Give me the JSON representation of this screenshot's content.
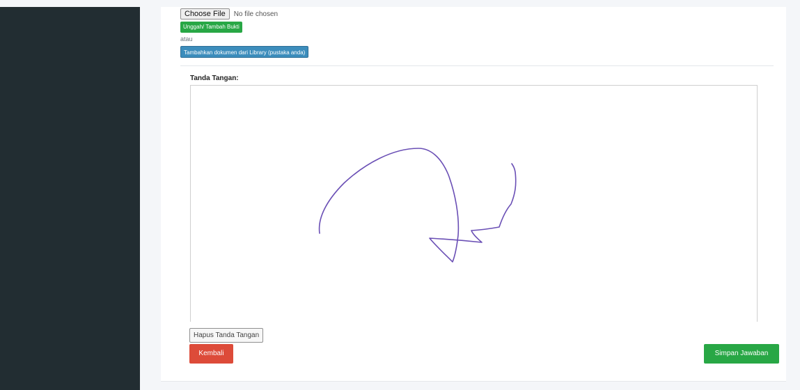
{
  "file_input": {
    "button_label": "Choose File",
    "status": "No file chosen"
  },
  "upload_button_label": "Unggah/ Tambah Bukti",
  "or_text": "atau",
  "library_button_label": "Tambahkan dokumen dari Library (pustaka anda)",
  "signature": {
    "label": "Tanda Tangan:",
    "stroke_color": "#6a4fb5"
  },
  "clear_button_label": "Hapus Tanda Tangan",
  "back_button_label": "Kembali",
  "save_button_label": "Simpan Jawaban",
  "colors": {
    "sidebar": "#222d32",
    "success": "#28a745",
    "danger": "#dd4b39",
    "primary": "#3c8dbc"
  }
}
